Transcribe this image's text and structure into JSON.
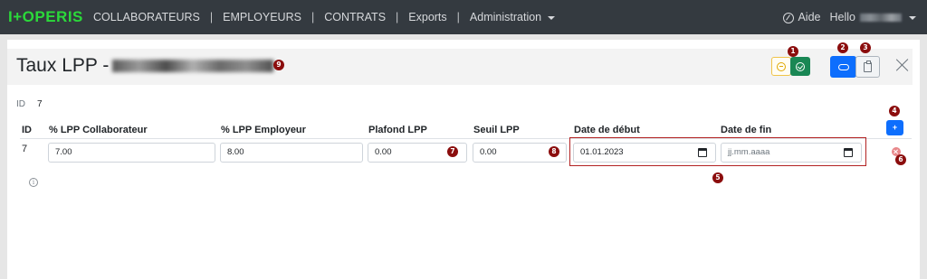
{
  "app": {
    "logo": "I+OPERIS"
  },
  "nav": {
    "items": [
      {
        "label": "COLLABORATEURS"
      },
      {
        "label": "EMPLOYEURS"
      },
      {
        "label": "CONTRATS"
      },
      {
        "label": "Exports"
      },
      {
        "label": "Administration"
      }
    ],
    "separator": "|",
    "help": "Aide",
    "greeting": "Hello"
  },
  "page": {
    "title": "Taux LPP -",
    "id_label": "ID",
    "id_value": "7"
  },
  "markers": [
    "1",
    "2",
    "3",
    "4",
    "5",
    "6",
    "7",
    "8",
    "9"
  ],
  "table": {
    "headers": [
      "ID",
      "% LPP Collaborateur",
      "% LPP Employeur",
      "Plafond LPP",
      "Seuil LPP",
      "Date de début",
      "Date de fin"
    ],
    "row": {
      "id": "7",
      "collaborateur": "7.00",
      "employeur": "8.00",
      "plafond": "0.00",
      "seuil": "0.00",
      "date_debut": "01.01.2023",
      "date_fin": "jj.mm.aaaa"
    },
    "add_label": "+"
  },
  "colors": {
    "navbar": "#343a40",
    "logo": "#2bd93a",
    "primary": "#0d6efd",
    "success": "#198754",
    "warning": "#f0c44a",
    "marker": "#8b0d0d"
  },
  "icons": {
    "help": "help-circle-icon",
    "cancel": "minus-circle-icon",
    "confirm": "check-circle-icon",
    "cloud": "cloud-icon",
    "clipboard": "clipboard-icon",
    "close": "close-icon",
    "delete": "x-circle-icon",
    "info": "info-icon",
    "calendar": "calendar-icon"
  }
}
